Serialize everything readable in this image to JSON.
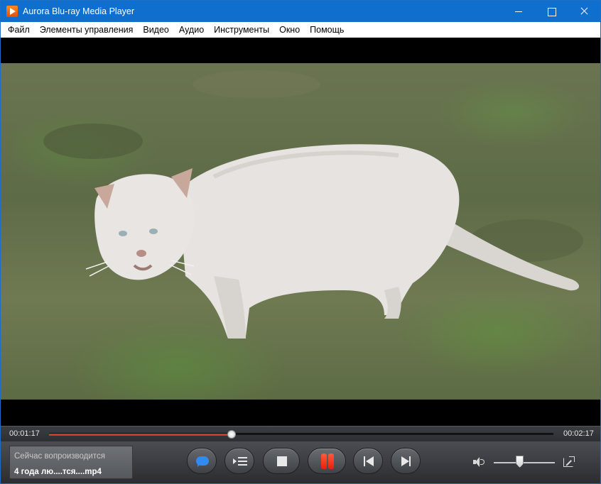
{
  "window": {
    "title": "Aurora Blu-ray Media Player",
    "accent_color": "#0e6fcf"
  },
  "menu": {
    "items": [
      "Файл",
      "Элементы управления",
      "Видео",
      "Аудио",
      "Инструменты",
      "Окно",
      "Помощь"
    ]
  },
  "video": {
    "content": "video-frame"
  },
  "playback": {
    "elapsed": "00:01:17",
    "total": "00:02:17",
    "progress_fraction": 0.362,
    "progress_color": "#c83a2a",
    "volume_fraction": 0.42
  },
  "now_playing": {
    "label": "Сейчас вопроизводится",
    "file": "4 года лю....тся....mp4"
  },
  "controls": {
    "buttons": [
      {
        "name": "subtitles-button",
        "icon": "chat-bubble-icon"
      },
      {
        "name": "playlist-button",
        "icon": "playlist-icon"
      },
      {
        "name": "stop-button",
        "icon": "stop-icon"
      },
      {
        "name": "pause-button",
        "icon": "pause-icon",
        "color": "#e8200c"
      },
      {
        "name": "previous-button",
        "icon": "skip-previous-icon"
      },
      {
        "name": "next-button",
        "icon": "skip-next-icon"
      }
    ],
    "volume_icon": "speaker-icon",
    "popout_icon": "popout-icon"
  }
}
